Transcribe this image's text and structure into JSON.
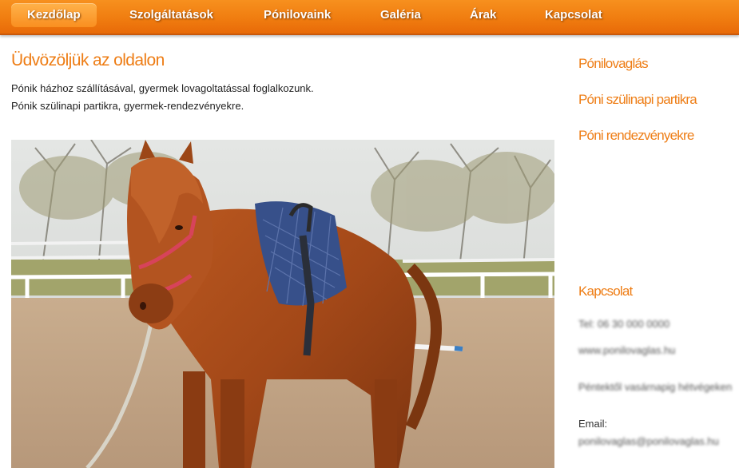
{
  "nav": {
    "items": [
      {
        "label": "Kezdőlap",
        "active": true
      },
      {
        "label": "Szolgáltatások",
        "active": false
      },
      {
        "label": "Pónilovaink",
        "active": false
      },
      {
        "label": "Galéria",
        "active": false
      },
      {
        "label": "Árak",
        "active": false
      },
      {
        "label": "Kapcsolat",
        "active": false
      }
    ]
  },
  "main": {
    "title": "Üdvözöljük az oldalon",
    "paragraphs": [
      "Pónik házhoz szállításával, gyermek lovagoltatással foglalkozunk.",
      "Pónik szülinapi partikra, gyermek-rendezvényekre."
    ]
  },
  "sidebar": {
    "links": [
      "Pónilovaglás",
      "Póni szülinapi partikra",
      "Póni rendezvényekre"
    ],
    "contact": {
      "title": "Kapcsolat",
      "phone": "Tel: 06 30 000 0000",
      "web": "www.ponilovaglas.hu",
      "hours": "Péntektől vasárnapig hétvégeken",
      "email_label": "Email:",
      "email": "ponilovaglas@ponilovaglas.hu"
    }
  },
  "colors": {
    "accent": "#ee7d15",
    "nav_top": "#f7901e",
    "nav_bottom": "#e86a08"
  }
}
